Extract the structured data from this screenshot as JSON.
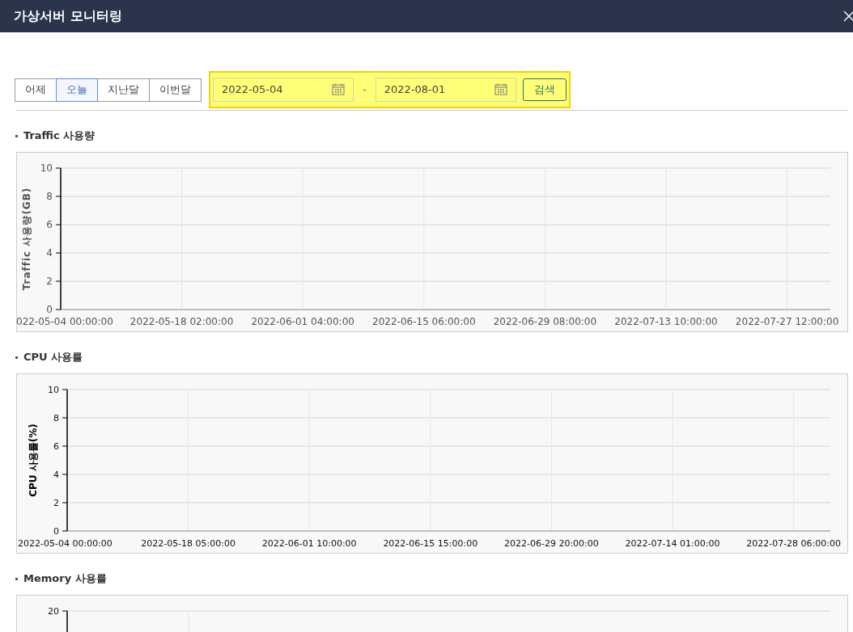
{
  "window": {
    "title": "가상서버 모니터링"
  },
  "period_buttons": [
    {
      "label": "어제",
      "selected": false
    },
    {
      "label": "오늘",
      "selected": true
    },
    {
      "label": "지난달",
      "selected": false
    },
    {
      "label": "이번달",
      "selected": false
    }
  ],
  "date_range": {
    "start": "2022-05-04",
    "separator": "-",
    "end": "2022-08-01",
    "search_button": "검색"
  },
  "sections": [
    {
      "title": "Traffic 사용량",
      "chart_data": {
        "type": "line",
        "grid": true,
        "ylabel": "Traffic 사용량(GB)",
        "ylim": [
          0,
          10
        ],
        "yticks": [
          0,
          2,
          4,
          6,
          8,
          10
        ],
        "categories": [
          "022-05-04 00:00:00",
          "2022-05-18 02:00:00",
          "2022-06-01 04:00:00",
          "2022-06-15 06:00:00",
          "2022-06-29 08:00:00",
          "2022-07-13 10:00:00",
          "2022-07-27 12:00:00"
        ]
      }
    },
    {
      "title": "CPU 사용률",
      "chart_data": {
        "type": "line",
        "grid": true,
        "ylabel": "CPU 사용률(%)",
        "ylim": [
          0,
          10
        ],
        "yticks": [
          0,
          2,
          4,
          6,
          8,
          10
        ],
        "categories": [
          "2022-05-04 00:00:00",
          "2022-05-18 05:00:00",
          "2022-06-01 10:00:00",
          "2022-06-15 15:00:00",
          "2022-06-29 20:00:00",
          "2022-07-14 01:00:00",
          "2022-07-28 06:00:00"
        ]
      }
    },
    {
      "title": "Memory 사용률",
      "top_tick_label": "20"
    }
  ]
}
